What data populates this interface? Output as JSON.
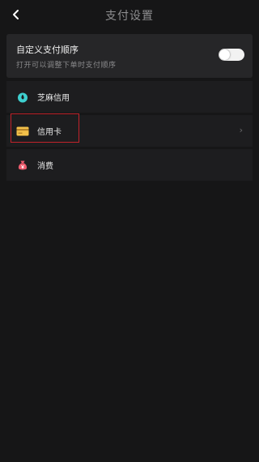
{
  "header": {
    "title": "支付设置"
  },
  "toggle_section": {
    "title": "自定义支付顺序",
    "subtitle": "打开可以调整下单时支付顺序",
    "enabled": false
  },
  "payment_methods": [
    {
      "label": "芝麻信用",
      "icon": "sesame-credit-icon",
      "icon_color": "#3ecfcf"
    },
    {
      "label": "信用卡",
      "icon": "credit-card-icon",
      "icon_color": "#f3c14a",
      "has_chevron": true,
      "chevron": "›"
    },
    {
      "label": "消费",
      "icon": "money-bag-icon",
      "icon_color": "#ec5b6d"
    }
  ],
  "colors": {
    "background": "#161617",
    "card": "#262628",
    "highlight": "#c2232b"
  }
}
